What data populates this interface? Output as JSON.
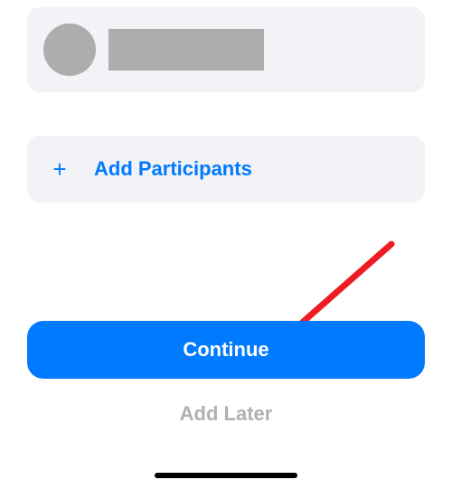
{
  "participant": {
    "name": ""
  },
  "add_participants": {
    "icon": "+",
    "label": "Add Participants"
  },
  "buttons": {
    "continue": "Continue",
    "add_later": "Add Later"
  },
  "colors": {
    "accent": "#007AFF",
    "card_bg": "#F2F2F7",
    "redacted": "#adadad",
    "disabled_text": "#b0b0b5"
  }
}
